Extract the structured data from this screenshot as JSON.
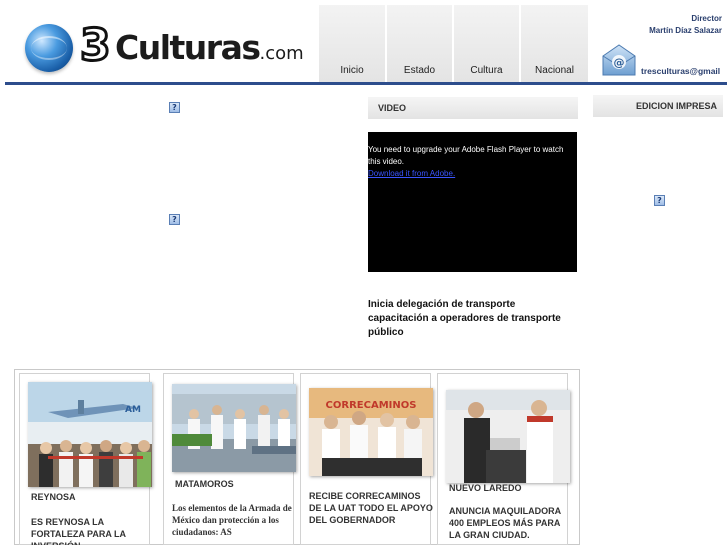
{
  "header": {
    "logo_three": "3",
    "logo_word": "Culturas",
    "logo_suffix": ".com",
    "director_label": "Director",
    "director_name": "Martín Díaz Salazar",
    "email": "tresculturas@gmail"
  },
  "nav": {
    "items": [
      {
        "label": "Inicio"
      },
      {
        "label": "Estado"
      },
      {
        "label": "Cultura"
      },
      {
        "label": "Nacional"
      }
    ]
  },
  "placeholders": {
    "glyph": "?"
  },
  "video": {
    "section_title": "VIDEO",
    "flash_message": "You need to upgrade your Adobe Flash Player to watch this video.",
    "flash_link": "Download it from Adobe."
  },
  "edicion": {
    "section_title": "EDICION IMPRESA"
  },
  "headline": "Inicia delegación de transporte capacitación a operadores de transporte público",
  "news": [
    {
      "place": "REYNOSA",
      "title": "ES REYNOSA LA FORTALEZA PARA LA INVERSIÓN"
    },
    {
      "place": "MATAMOROS",
      "body": "Los elementos de la Armada de México dan protección a los ciudadanos: AS"
    },
    {
      "title": "RECIBE CORRECAMINOS DE LA UAT TODO EL APOYO DEL GOBERNADOR"
    },
    {
      "place": "NUEVO LAREDO",
      "title": "ANUNCIA MAQUILADORA 400 EMPLEOS MÁS PARA LA GRAN CIUDAD."
    }
  ],
  "colors": {
    "brand_blue": "#2d4d8c",
    "header_text": "#2a3f6e"
  }
}
